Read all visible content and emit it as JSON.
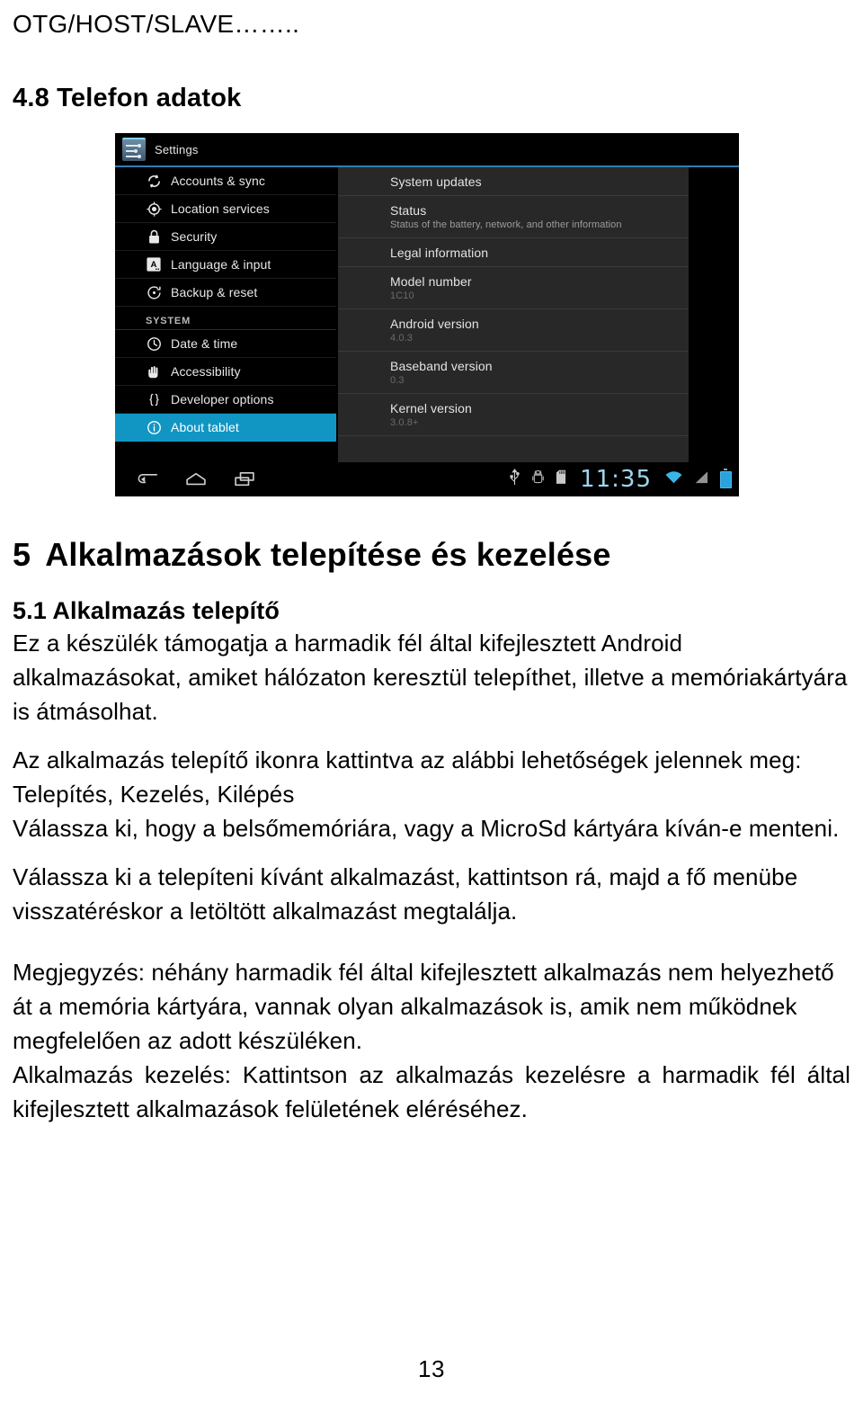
{
  "document": {
    "running_header": "OTG/HOST/SLAVE……..",
    "section_heading": "4.8 Telefon adatok",
    "chapter_number": "5",
    "chapter_title": "Alkalmazások telepítése és kezelése",
    "section_title": "5.1 Alkalmazás telepítő",
    "paragraphs": {
      "p1": "Ez a készülék támogatja a harmadik fél által kifejlesztett Android alkalmazásokat, amiket hálózaton keresztül telepíthet, illetve a memóriakártyára is átmásolhat.",
      "p2_line1": "Az alkalmazás telepítő ikonra kattintva az alábbi lehetőségek jelennek meg:",
      "p2_line2": "Telepítés, Kezelés, Kilépés",
      "p3": "Válassza ki, hogy a belsőmemóriára, vagy a MicroSd kártyára kíván-e menteni.",
      "p4": "Válassza ki a telepíteni kívánt alkalmazást, kattintson rá, majd a fő menübe visszatéréskor a letöltött alkalmazást megtalálja.",
      "p5": "Megjegyzés: néhány harmadik fél által kifejlesztett alkalmazás nem helyezhető át a memória kártyára, vannak olyan alkalmazások is, amik nem működnek megfelelően az adott készüléken.",
      "p6": "Alkalmazás kezelés: Kattintson az alkalmazás kezelésre a harmadik fél által kifejlesztett alkalmazások felületének eléréséhez."
    },
    "page_number": "13"
  },
  "figure": {
    "action_bar": {
      "icon": "settings-sliders-icon",
      "title": "Settings",
      "accent_color": "#2f7fb5"
    },
    "sidebar": {
      "selected_color": "#1196c4",
      "items": [
        {
          "icon": "sync-icon",
          "label": "Accounts & sync",
          "selected": false,
          "type": "item"
        },
        {
          "icon": "location-icon",
          "label": "Location services",
          "selected": false,
          "type": "item"
        },
        {
          "icon": "lock-icon",
          "label": "Security",
          "selected": false,
          "type": "item"
        },
        {
          "icon": "language-icon",
          "label": "Language & input",
          "selected": false,
          "type": "item"
        },
        {
          "icon": "backup-reset-icon",
          "label": "Backup & reset",
          "selected": false,
          "type": "item"
        },
        {
          "icon": "",
          "label": "SYSTEM",
          "selected": false,
          "type": "category"
        },
        {
          "icon": "clock-icon",
          "label": "Date & time",
          "selected": false,
          "type": "item"
        },
        {
          "icon": "hand-icon",
          "label": "Accessibility",
          "selected": false,
          "type": "item"
        },
        {
          "icon": "braces-icon",
          "label": "Developer options",
          "selected": false,
          "type": "item"
        },
        {
          "icon": "info-icon",
          "label": "About tablet",
          "selected": true,
          "type": "item"
        }
      ]
    },
    "detail": {
      "rows": [
        {
          "title": "System updates",
          "value": ""
        },
        {
          "title": "Status",
          "value": "Status of the battery, network, and other information"
        },
        {
          "title": "Legal information",
          "value": ""
        },
        {
          "title": "Model number",
          "value": "1C10"
        },
        {
          "title": "Android version",
          "value": "4.0.3"
        },
        {
          "title": "Baseband version",
          "value": "0.3"
        },
        {
          "title": "Kernel version",
          "value": "3.0.8+"
        }
      ]
    },
    "navbar": {
      "back": "back-icon",
      "home": "home-icon",
      "recents": "recent-apps-icon",
      "status_icons": [
        "usb-icon",
        "android-debug-icon",
        "sd-card-icon"
      ],
      "clock": "11:35",
      "wifi": "wifi-icon",
      "signal": "signal-icon",
      "battery": "battery-charging-icon",
      "clock_color": "#9fd5ef"
    }
  }
}
